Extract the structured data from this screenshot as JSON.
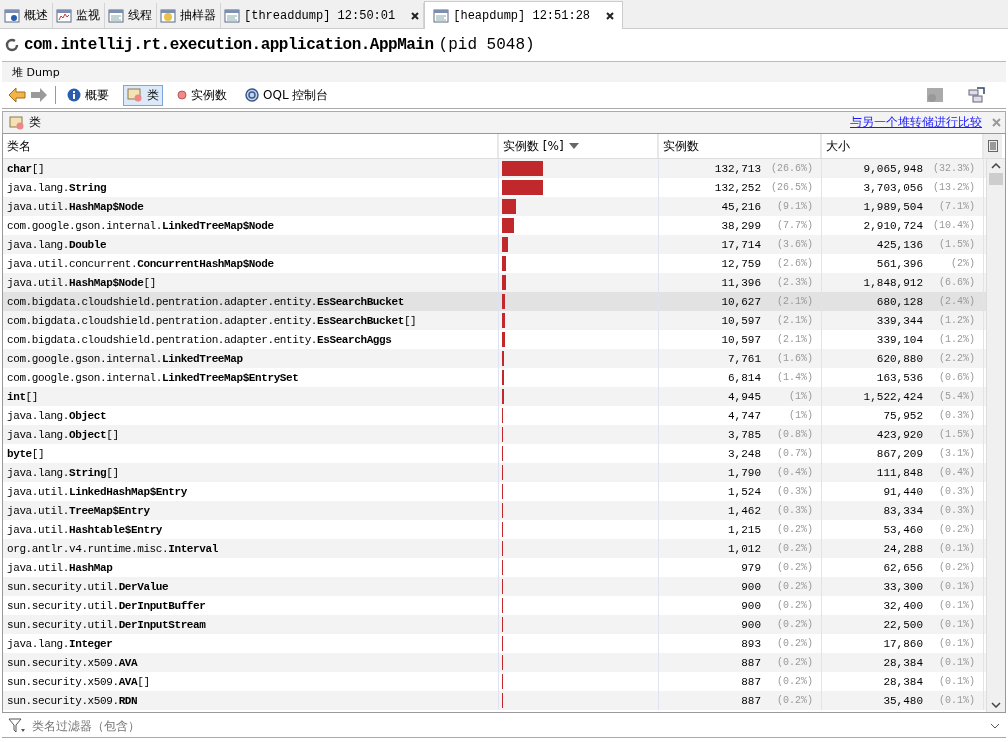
{
  "tabs": [
    {
      "label": "概述",
      "selected": false,
      "closable": false
    },
    {
      "label": "监视",
      "selected": false,
      "closable": false
    },
    {
      "label": "线程",
      "selected": false,
      "closable": false
    },
    {
      "label": "抽样器",
      "selected": false,
      "closable": false
    },
    {
      "label": "[threaddump] 12:50:01",
      "selected": false,
      "closable": true
    },
    {
      "label": "[heapdump] 12:51:28",
      "selected": true,
      "closable": true
    }
  ],
  "title": {
    "main": "com.intellij.rt.execution.application.AppMain",
    "pid": "(pid 5048)"
  },
  "section_label": "堆 Dump",
  "toolbar": {
    "back_disabled": false,
    "forward_disabled": true,
    "views": [
      {
        "label": "概要",
        "selected": false
      },
      {
        "label": "类",
        "selected": true
      },
      {
        "label": "实例数",
        "selected": false
      },
      {
        "label": "OQL 控制台",
        "selected": false
      }
    ]
  },
  "panel": {
    "title": "类",
    "compare_link": "与另一个堆转储进行比较"
  },
  "table": {
    "columns": [
      "类名",
      "实例数 [%]",
      "实例数",
      "大小"
    ],
    "rows": [
      {
        "name": "**char**[]",
        "level": 0.266,
        "count": "132,713",
        "count_pct": "(26.6%)",
        "size": "9,065,948",
        "size_pct": "(32.3%)",
        "selected": false
      },
      {
        "name": "java.lang.**String**",
        "level": 0.265,
        "count": "132,252",
        "count_pct": "(26.5%)",
        "size": "3,703,056",
        "size_pct": "(13.2%)",
        "selected": false
      },
      {
        "name": "java.util.**HashMap$Node**",
        "level": 0.091,
        "count": "45,216",
        "count_pct": "(9.1%)",
        "size": "1,989,504",
        "size_pct": "(7.1%)",
        "selected": false
      },
      {
        "name": "com.google.gson.internal.**LinkedTreeMap$Node**",
        "level": 0.077,
        "count": "38,299",
        "count_pct": "(7.7%)",
        "size": "2,910,724",
        "size_pct": "(10.4%)",
        "selected": false
      },
      {
        "name": "java.lang.**Double**",
        "level": 0.036,
        "count": "17,714",
        "count_pct": "(3.6%)",
        "size": "425,136",
        "size_pct": "(1.5%)",
        "selected": false
      },
      {
        "name": "java.util.concurrent.**ConcurrentHashMap$Node**",
        "level": 0.026,
        "count": "12,759",
        "count_pct": "(2.6%)",
        "size": "561,396",
        "size_pct": "(2%)",
        "selected": false
      },
      {
        "name": "java.util.**HashMap$Node**[]",
        "level": 0.023,
        "count": "11,396",
        "count_pct": "(2.3%)",
        "size": "1,848,912",
        "size_pct": "(6.6%)",
        "selected": false
      },
      {
        "name": "com.bigdata.cloudshield.pentration.adapter.entity.**EsSearchBucket**",
        "level": 0.021,
        "count": "10,627",
        "count_pct": "(2.1%)",
        "size": "680,128",
        "size_pct": "(2.4%)",
        "selected": true
      },
      {
        "name": "com.bigdata.cloudshield.pentration.adapter.entity.**EsSearchBucket**[]",
        "level": 0.021,
        "count": "10,597",
        "count_pct": "(2.1%)",
        "size": "339,344",
        "size_pct": "(1.2%)",
        "selected": false
      },
      {
        "name": "com.bigdata.cloudshield.pentration.adapter.entity.**EsSearchAggs**",
        "level": 0.021,
        "count": "10,597",
        "count_pct": "(2.1%)",
        "size": "339,104",
        "size_pct": "(1.2%)",
        "selected": false
      },
      {
        "name": "com.google.gson.internal.**LinkedTreeMap**",
        "level": 0.016,
        "count": "7,761",
        "count_pct": "(1.6%)",
        "size": "620,880",
        "size_pct": "(2.2%)",
        "selected": false
      },
      {
        "name": "com.google.gson.internal.**LinkedTreeMap$EntrySet**",
        "level": 0.014,
        "count": "6,814",
        "count_pct": "(1.4%)",
        "size": "163,536",
        "size_pct": "(0.6%)",
        "selected": false
      },
      {
        "name": "**int**[]",
        "level": 0.01,
        "count": "4,945",
        "count_pct": "(1%)",
        "size": "1,522,424",
        "size_pct": "(5.4%)",
        "selected": false
      },
      {
        "name": "java.lang.**Object**",
        "level": 0.0095,
        "count": "4,747",
        "count_pct": "(1%)",
        "size": "75,952",
        "size_pct": "(0.3%)",
        "selected": false
      },
      {
        "name": "java.lang.**Object**[]",
        "level": 0.008,
        "count": "3,785",
        "count_pct": "(0.8%)",
        "size": "423,920",
        "size_pct": "(1.5%)",
        "selected": false
      },
      {
        "name": "**byte**[]",
        "level": 0.007,
        "count": "3,248",
        "count_pct": "(0.7%)",
        "size": "867,209",
        "size_pct": "(3.1%)",
        "selected": false
      },
      {
        "name": "java.lang.**String**[]",
        "level": 0.004,
        "count": "1,790",
        "count_pct": "(0.4%)",
        "size": "111,848",
        "size_pct": "(0.4%)",
        "selected": false
      },
      {
        "name": "java.util.**LinkedHashMap$Entry**",
        "level": 0.003,
        "count": "1,524",
        "count_pct": "(0.3%)",
        "size": "91,440",
        "size_pct": "(0.3%)",
        "selected": false
      },
      {
        "name": "java.util.**TreeMap$Entry**",
        "level": 0.003,
        "count": "1,462",
        "count_pct": "(0.3%)",
        "size": "83,334",
        "size_pct": "(0.3%)",
        "selected": false
      },
      {
        "name": "java.util.**Hashtable$Entry**",
        "level": 0.002,
        "count": "1,215",
        "count_pct": "(0.2%)",
        "size": "53,460",
        "size_pct": "(0.2%)",
        "selected": false
      },
      {
        "name": "org.antlr.v4.runtime.misc.**Interval**",
        "level": 0.002,
        "count": "1,012",
        "count_pct": "(0.2%)",
        "size": "24,288",
        "size_pct": "(0.1%)",
        "selected": false
      },
      {
        "name": "java.util.**HashMap**",
        "level": 0.002,
        "count": "979",
        "count_pct": "(0.2%)",
        "size": "62,656",
        "size_pct": "(0.2%)",
        "selected": false
      },
      {
        "name": "sun.security.util.**DerValue**",
        "level": 0.002,
        "count": "900",
        "count_pct": "(0.2%)",
        "size": "33,300",
        "size_pct": "(0.1%)",
        "selected": false
      },
      {
        "name": "sun.security.util.**DerInputBuffer**",
        "level": 0.002,
        "count": "900",
        "count_pct": "(0.2%)",
        "size": "32,400",
        "size_pct": "(0.1%)",
        "selected": false
      },
      {
        "name": "sun.security.util.**DerInputStream**",
        "level": 0.002,
        "count": "900",
        "count_pct": "(0.2%)",
        "size": "22,500",
        "size_pct": "(0.1%)",
        "selected": false
      },
      {
        "name": "java.lang.**Integer**",
        "level": 0.002,
        "count": "893",
        "count_pct": "(0.2%)",
        "size": "17,860",
        "size_pct": "(0.1%)",
        "selected": false
      },
      {
        "name": "sun.security.x509.**AVA**",
        "level": 0.002,
        "count": "887",
        "count_pct": "(0.2%)",
        "size": "28,384",
        "size_pct": "(0.1%)",
        "selected": false
      },
      {
        "name": "sun.security.x509.**AVA**[]",
        "level": 0.002,
        "count": "887",
        "count_pct": "(0.2%)",
        "size": "28,384",
        "size_pct": "(0.1%)",
        "selected": false
      },
      {
        "name": "sun.security.x509.**RDN**",
        "level": 0.002,
        "count": "887",
        "count_pct": "(0.2%)",
        "size": "35,480",
        "size_pct": "(0.1%)",
        "selected": false
      }
    ]
  },
  "filter": {
    "placeholder": "类名过滤器（包含）"
  }
}
